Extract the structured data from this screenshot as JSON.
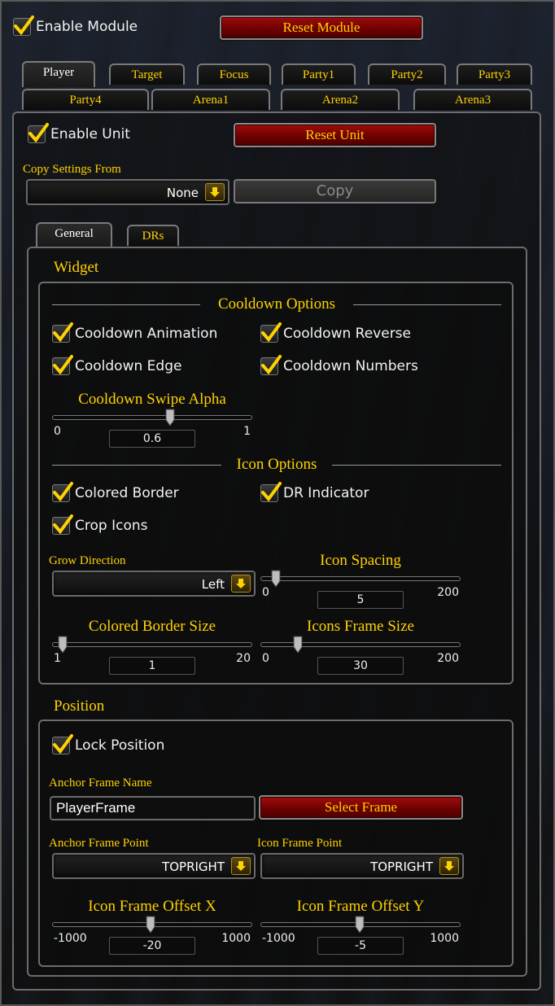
{
  "module": {
    "enable_label": "Enable Module",
    "reset_label": "Reset Module"
  },
  "tabs_row1": [
    "Player",
    "Target",
    "Focus",
    "Party1",
    "Party2",
    "Party3"
  ],
  "tabs_row2": [
    "Party4",
    "Arena1",
    "Arena2",
    "Arena3"
  ],
  "unit": {
    "enable_label": "Enable Unit",
    "reset_label": "Reset Unit",
    "copy_settings_label": "Copy Settings From",
    "copy_source_value": "None",
    "copy_button_label": "Copy"
  },
  "subtabs": [
    "General",
    "DRs"
  ],
  "widget": {
    "header": "Widget",
    "cooldown_section": "Cooldown Options",
    "cooldown_animation": "Cooldown Animation",
    "cooldown_reverse": "Cooldown Reverse",
    "cooldown_edge": "Cooldown Edge",
    "cooldown_numbers": "Cooldown Numbers",
    "swipe_alpha": {
      "title": "Cooldown Swipe Alpha",
      "min": "0",
      "max": "1",
      "value": "0.6",
      "fraction": 0.6
    },
    "icon_section": "Icon Options",
    "colored_border": "Colored Border",
    "dr_indicator": "DR Indicator",
    "crop_icons": "Crop Icons",
    "grow_direction_label": "Grow Direction",
    "grow_direction_value": "Left",
    "icon_spacing": {
      "title": "Icon Spacing",
      "min": "0",
      "max": "200",
      "value": "5",
      "fraction": 0.025
    },
    "colored_border_size": {
      "title": "Colored Border Size",
      "min": "1",
      "max": "20",
      "value": "1",
      "fraction": 0.0
    },
    "icons_frame_size": {
      "title": "Icons Frame Size",
      "min": "0",
      "max": "200",
      "value": "30",
      "fraction": 0.15
    }
  },
  "position": {
    "header": "Position",
    "lock_position": "Lock Position",
    "anchor_frame_name_label": "Anchor Frame Name",
    "anchor_frame_name_value": "PlayerFrame",
    "select_frame_label": "Select Frame",
    "anchor_frame_point_label": "Anchor Frame Point",
    "anchor_frame_point_value": "TOPRIGHT",
    "icon_frame_point_label": "Icon Frame Point",
    "icon_frame_point_value": "TOPRIGHT",
    "offset_x": {
      "title": "Icon Frame Offset X",
      "min": "-1000",
      "max": "1000",
      "value": "-20",
      "fraction": 0.49
    },
    "offset_y": {
      "title": "Icon Frame Offset Y",
      "min": "-1000",
      "max": "1000",
      "value": "-5",
      "fraction": 0.4975
    }
  },
  "colors": {
    "accent_gold": "#ffd200",
    "button_red": "#8b0000"
  }
}
